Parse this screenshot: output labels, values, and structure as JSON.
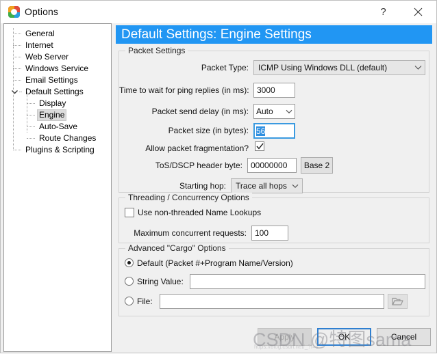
{
  "window": {
    "title": "Options",
    "icon": "options-app-icon",
    "help_label": "?",
    "close_label": "✕"
  },
  "sidebar": {
    "items": [
      {
        "label": "General",
        "level": 1,
        "selected": false,
        "expandable": false
      },
      {
        "label": "Internet",
        "level": 1,
        "selected": false,
        "expandable": false
      },
      {
        "label": "Web Server",
        "level": 1,
        "selected": false,
        "expandable": false
      },
      {
        "label": "Windows Service",
        "level": 1,
        "selected": false,
        "expandable": false
      },
      {
        "label": "Email Settings",
        "level": 1,
        "selected": false,
        "expandable": false
      },
      {
        "label": "Default Settings",
        "level": 1,
        "selected": false,
        "expandable": true
      },
      {
        "label": "Display",
        "level": 2,
        "selected": false,
        "expandable": false
      },
      {
        "label": "Engine",
        "level": 2,
        "selected": true,
        "expandable": false
      },
      {
        "label": "Auto-Save",
        "level": 2,
        "selected": false,
        "expandable": false
      },
      {
        "label": "Route Changes",
        "level": 2,
        "selected": false,
        "expandable": false
      },
      {
        "label": "Plugins & Scripting",
        "level": 1,
        "selected": false,
        "expandable": false
      }
    ]
  },
  "main": {
    "banner_title": "Default Settings: Engine Settings",
    "banner_color": "#2196f3",
    "packet_settings": {
      "group_title": "Packet Settings",
      "packet_type_label": "Packet Type:",
      "packet_type_value": "ICMP Using Windows DLL (default)",
      "wait_time_label": "Time to wait for ping replies (in ms):",
      "wait_time_value": "3000",
      "send_delay_label": "Packet send delay (in ms):",
      "send_delay_value": "Auto",
      "packet_size_label": "Packet size (in bytes):",
      "packet_size_value": "56",
      "fragmentation_label": "Allow packet fragmentation?",
      "fragmentation_checked": true,
      "tos_label": "ToS/DSCP header byte:",
      "tos_value": "00000000",
      "base_button_label": "Base 2",
      "starting_hop_label": "Starting hop:",
      "starting_hop_value": "Trace all hops"
    },
    "threading": {
      "group_title": "Threading / Concurrency Options",
      "non_threaded_label": "Use non-threaded Name Lookups",
      "non_threaded_checked": false,
      "max_requests_label": "Maximum concurrent requests:",
      "max_requests_value": "100"
    },
    "cargo": {
      "group_title": "Advanced \"Cargo\" Options",
      "default_label": "Default (Packet #+Program Name/Version)",
      "default_selected": true,
      "string_label": "String Value:",
      "string_selected": false,
      "string_value": "",
      "file_label": "File:",
      "file_selected": false,
      "file_value": "",
      "browse_icon": "folder-open-icon"
    }
  },
  "footer": {
    "apply_label": "Apply",
    "apply_disabled": true,
    "ok_label": "OK",
    "cancel_label": "Cancel"
  },
  "watermark": {
    "text": "CSDN @特图sama",
    "subtext": "https://blog.csdn.net/_?f=1"
  }
}
